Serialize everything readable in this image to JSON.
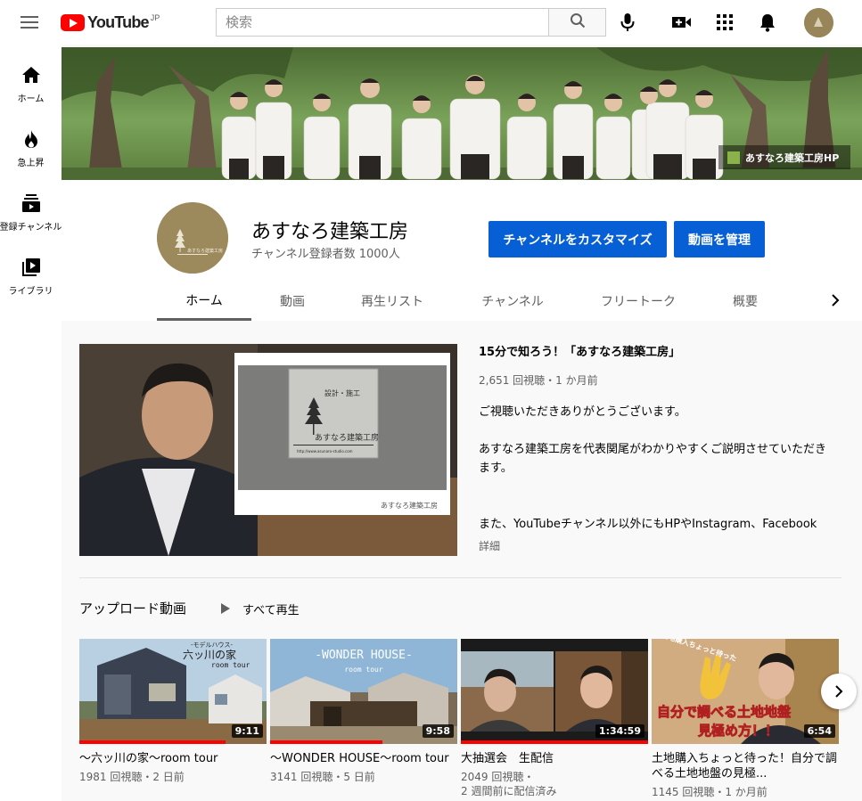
{
  "header": {
    "logo_text": "YouTube",
    "logo_region": "JP",
    "search_placeholder": "検索"
  },
  "sidebar": {
    "items": [
      {
        "label": "ホーム",
        "icon": "home-icon"
      },
      {
        "label": "急上昇",
        "icon": "fire-icon"
      },
      {
        "label": "登録チャンネル",
        "icon": "subscriptions-icon"
      },
      {
        "label": "ライブラリ",
        "icon": "library-icon"
      }
    ]
  },
  "banner": {
    "link_label": "あすなろ建築工房HP"
  },
  "channel": {
    "name": "あすなろ建築工房",
    "subscribers": "チャンネル登録者数 1000人",
    "customize_label": "チャンネルをカスタマイズ",
    "manage_label": "動画を管理",
    "tabs": [
      "ホーム",
      "動画",
      "再生リスト",
      "チャンネル",
      "フリートーク",
      "概要"
    ]
  },
  "featured": {
    "title": "15分で知ろう！「あすなろ建築工房」",
    "meta": "2,651 回視聴・1 か月前",
    "desc1": "ご視聴いただきありがとうございます。",
    "desc2": "あすなろ建築工房を代表関尾がわかりやすくご説明させていただきます。",
    "desc3": "また、YouTubeチャンネル以外にもHPやInstagram、Facebook",
    "more": "詳細",
    "sign_line1": "設計・施工",
    "sign_line2": "あすなろ建築工房",
    "sign_url": "http://www.asunaro-studio.com",
    "sign_footer": "あすなろ建築工房"
  },
  "uploads": {
    "title": "アップロード動画",
    "play_all": "すべて再生",
    "videos": [
      {
        "title": "〜六ッ川の家〜room tour",
        "meta": "1981 回視聴・2 日前",
        "duration": "9:11",
        "progress": 0.78,
        "thumb_line1": "-モデルハウス-",
        "thumb_line2": "六ッ川の家",
        "thumb_line3": "room tour"
      },
      {
        "title": "〜WONDER HOUSE〜room tour",
        "meta": "3141 回視聴・5 日前",
        "duration": "9:58",
        "progress": 0.6,
        "thumb_line1": "-WONDER HOUSE-",
        "thumb_line2": "room tour"
      },
      {
        "title": "大抽選会　生配信",
        "meta": "2049 回視聴・",
        "meta2": "2 週間前に配信済み",
        "duration": "1:34:59",
        "progress": 1.0
      },
      {
        "title": "土地購入ちょっと待った！自分で調べる土地地盤の見極...",
        "meta": "1145 回視聴・1 か月前",
        "duration": "6:54",
        "progress": 0.0,
        "thumb_line1": "土地購入ちょっと待った",
        "thumb_line2": "自分で調べる土地地盤",
        "thumb_line3": "見極め方！！"
      }
    ]
  },
  "colors": {
    "accent_blue": "#065fd4",
    "youtube_red": "#ff0000",
    "tab_underline": "#606060"
  }
}
